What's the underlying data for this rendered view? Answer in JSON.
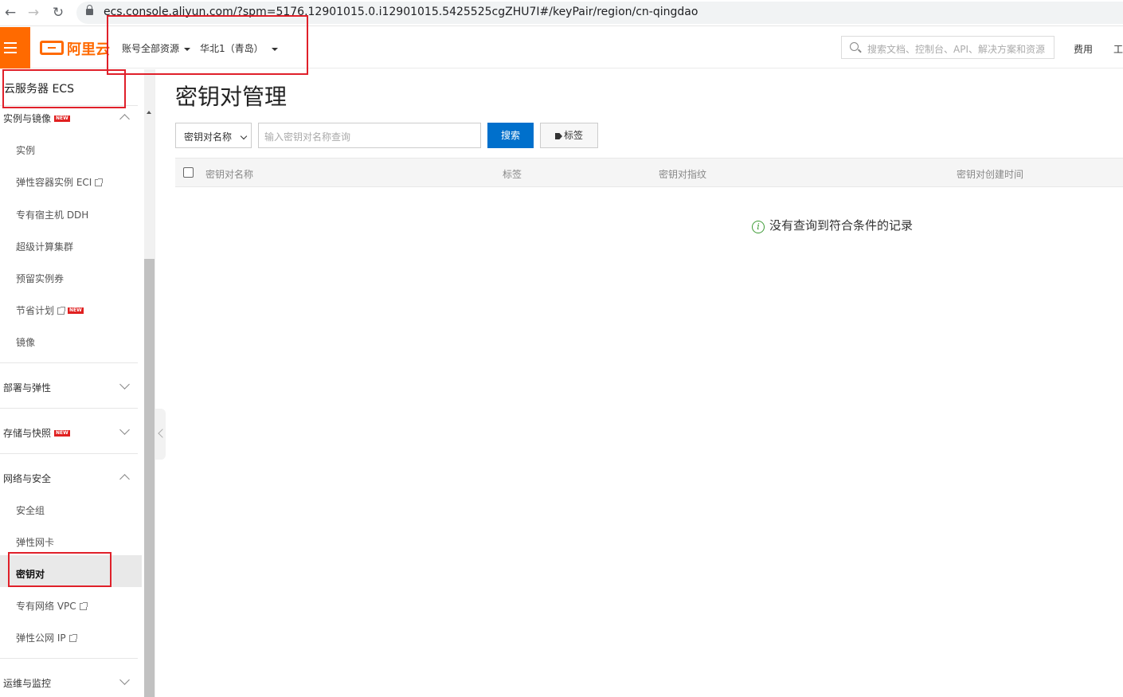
{
  "browser": {
    "url": "ecs.console.aliyun.com/?spm=5176.12901015.0.i12901015.5425525cgZHU7I#/keyPair/region/cn-qingdao"
  },
  "topnav": {
    "logo_text": "阿里云",
    "account_dropdown": "账号全部资源",
    "region_dropdown": "华北1（青岛）",
    "search_placeholder": "搜索文档、控制台、API、解决方案和资源",
    "fee_link": "费用",
    "work_link": "工"
  },
  "sidebar": {
    "title": "云服务器 ECS",
    "new_badge": "NEW",
    "groups": [
      {
        "label": "实例与镜像",
        "new": true,
        "items": [
          "实例",
          "弹性容器实例 ECI",
          "专有宿主机 DDH",
          "超级计算集群",
          "预留实例券",
          "节省计划",
          "镜像"
        ]
      },
      {
        "label": "部署与弹性"
      },
      {
        "label": "存储与快照",
        "new": true
      },
      {
        "label": "网络与安全",
        "items": [
          "安全组",
          "弹性网卡",
          "密钥对",
          "专有网络 VPC",
          "弹性公网 IP"
        ]
      },
      {
        "label": "运维与监控"
      }
    ]
  },
  "main": {
    "title": "密钥对管理",
    "filter_select": "密钥对名称",
    "search_placeholder": "输入密钥对名称查询",
    "search_button": "搜索",
    "tag_button": "标签",
    "columns": [
      "密钥对名称",
      "标签",
      "密钥对指纹",
      "密钥对创建时间"
    ],
    "empty_text": "没有查询到符合条件的记录"
  },
  "colors": {
    "brand": "#ff6a00",
    "primary": "#0070cc",
    "annotation": "#e0202a"
  }
}
